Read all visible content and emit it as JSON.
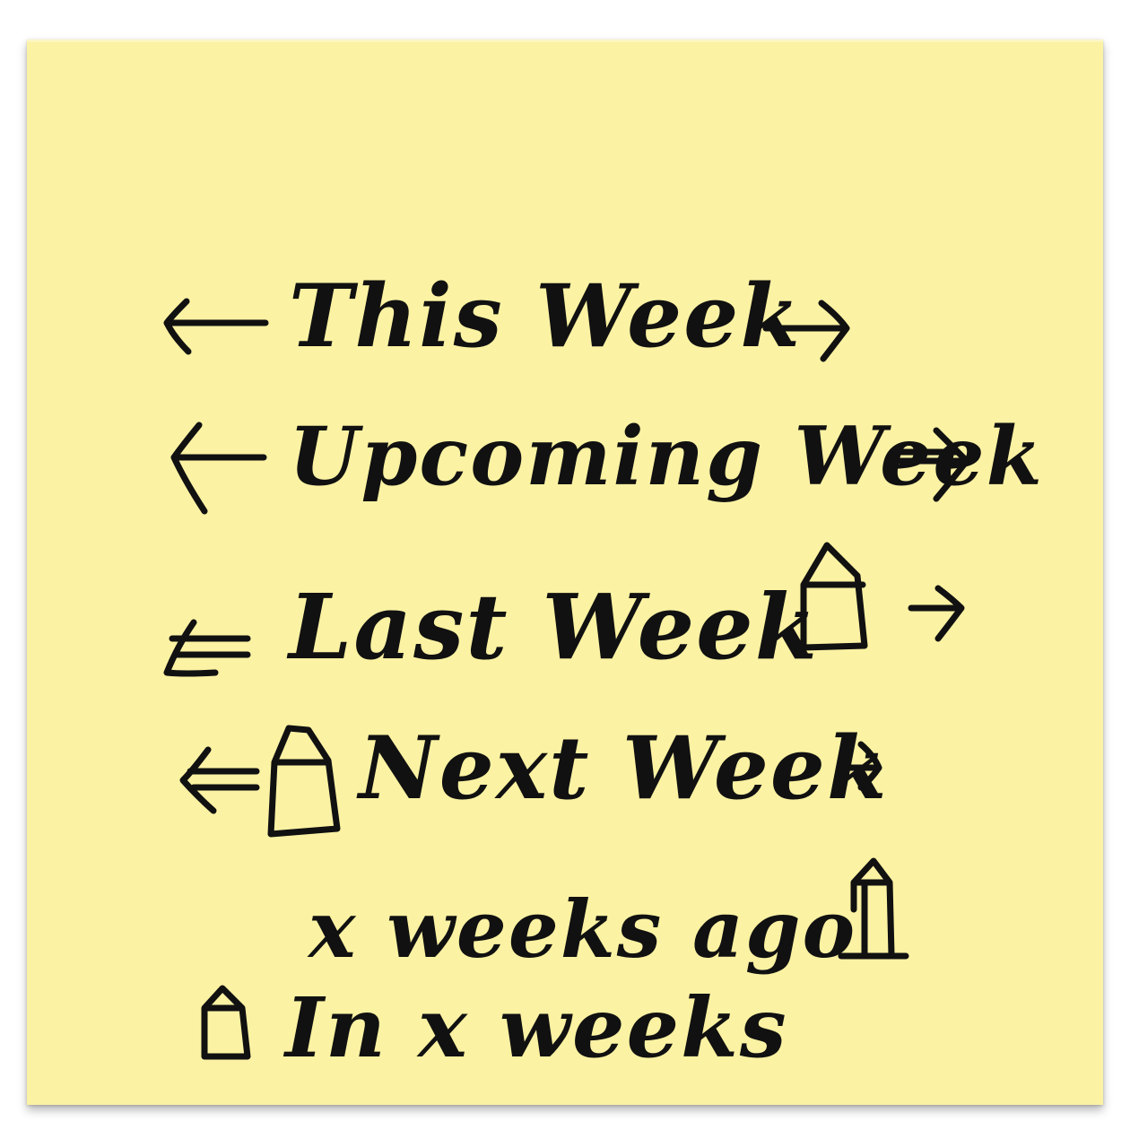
{
  "note": {
    "background": "#fbf2a3",
    "ink": "#111111",
    "lines": [
      {
        "text": "This Week",
        "left_icon": "arrow-left-icon",
        "right_icon": "arrow-right-icon"
      },
      {
        "text": "Upcoming Week",
        "left_icon": "arrow-left-icon",
        "right_icon": "arrow-right-icon"
      },
      {
        "text": "Last Week",
        "left_icon": "arrow-left-icon",
        "right_icons": [
          "house-icon",
          "arrow-right-icon"
        ]
      },
      {
        "text": "Next Week",
        "left_icons": [
          "arrow-left-icon",
          "house-icon"
        ],
        "right_icon": "arrow-right-icon"
      },
      {
        "text": "x weeks ago",
        "right_icon": "house-icon"
      },
      {
        "text": "In x weeks",
        "left_icon": "house-icon"
      }
    ]
  }
}
